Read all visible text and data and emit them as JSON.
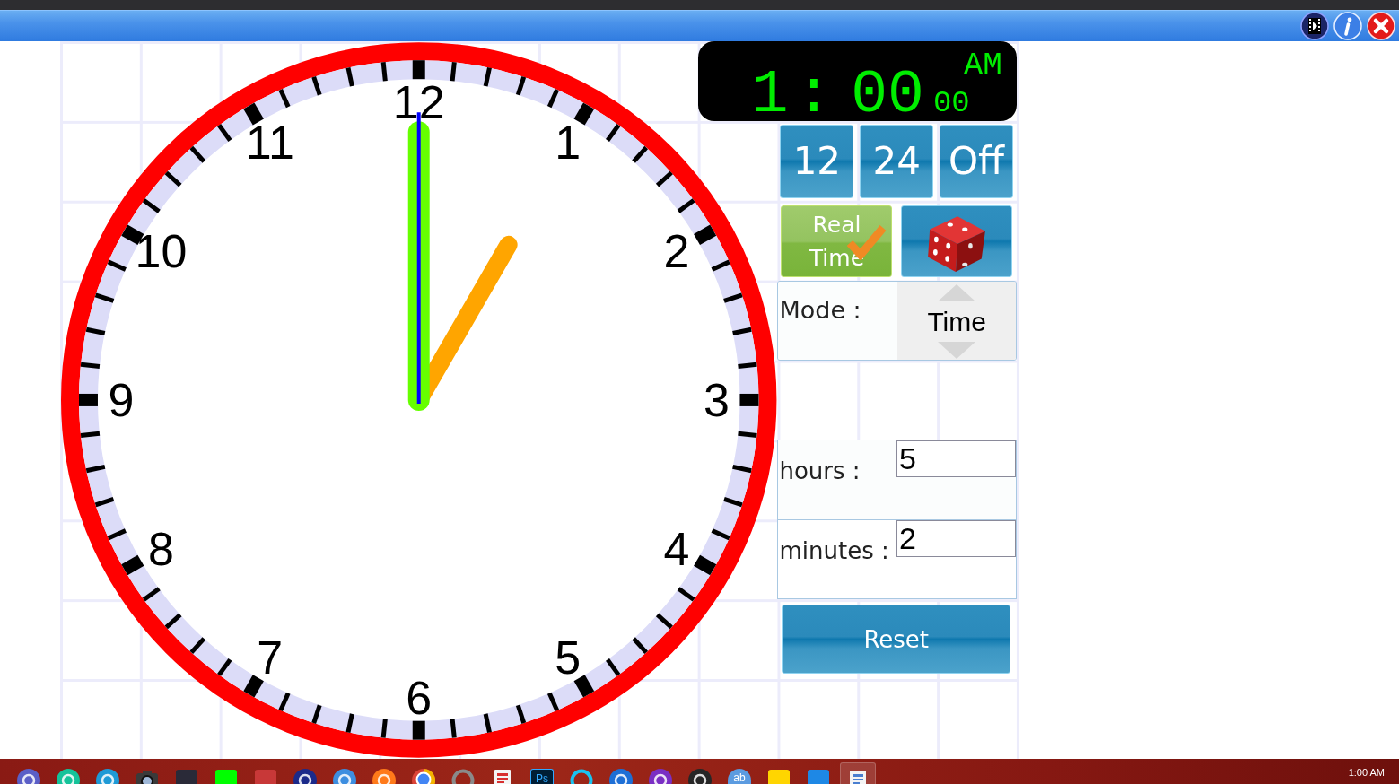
{
  "clock": {
    "numbers": [
      "12",
      "1",
      "2",
      "3",
      "4",
      "5",
      "6",
      "7",
      "8",
      "9",
      "10",
      "11"
    ]
  },
  "digital_display": {
    "hour": "1",
    "separator": ":",
    "minutes": "00",
    "seconds": "00",
    "period": "AM"
  },
  "format_buttons": [
    {
      "label": "12"
    },
    {
      "label": "24"
    },
    {
      "label": "Off"
    }
  ],
  "real_time_button": {
    "label": "Real Time",
    "checked": true
  },
  "mode": {
    "label": "Mode :",
    "value": "Time"
  },
  "fields": [
    {
      "label": "hours :",
      "value": "5"
    },
    {
      "label": "minutes :",
      "value": "2"
    }
  ],
  "reset_button": {
    "label": "Reset"
  },
  "taskbar": {
    "apps": [
      {
        "kind": "disc",
        "color": "#5b5fc7",
        "active": false
      },
      {
        "kind": "disc",
        "color": "#15c39a",
        "active": false
      },
      {
        "kind": "disc",
        "color": "#1f9ad6",
        "active": false
      },
      {
        "kind": "camera",
        "color": "#3a3a3a",
        "active": false
      },
      {
        "kind": "tile",
        "color": "#2a2a38",
        "active": false
      },
      {
        "kind": "tile",
        "color": "#00ff00",
        "active": false
      },
      {
        "kind": "tile",
        "color": "#c83838",
        "active": false
      },
      {
        "kind": "disc",
        "color": "#1b2a8a",
        "active": false
      },
      {
        "kind": "disc",
        "color": "#3d8ee0",
        "active": false
      },
      {
        "kind": "disc",
        "color": "#ff7a1a",
        "active": false
      },
      {
        "kind": "wheel",
        "color": "#4285f4",
        "active": false
      },
      {
        "kind": "ring",
        "color": "#8a8a8a",
        "active": false
      },
      {
        "kind": "page",
        "color": "#d83030",
        "active": false
      },
      {
        "kind": "tile",
        "color": "#001e36",
        "label": "Ps",
        "active": false
      },
      {
        "kind": "ring",
        "color": "#19c3f0",
        "active": false
      },
      {
        "kind": "disc",
        "color": "#1d6fd6",
        "active": false
      },
      {
        "kind": "disc",
        "color": "#7a2ec4",
        "active": false
      },
      {
        "kind": "disc",
        "color": "#262626",
        "active": false
      },
      {
        "kind": "disc",
        "color": "#5b9be0",
        "label": "ab",
        "active": false
      },
      {
        "kind": "tile",
        "color": "#ffd500",
        "active": false
      },
      {
        "kind": "tile",
        "color": "#1e88e5",
        "active": false
      },
      {
        "kind": "page",
        "color": "#4a7fd0",
        "active": true
      }
    ],
    "clock": "1:00 AM"
  }
}
